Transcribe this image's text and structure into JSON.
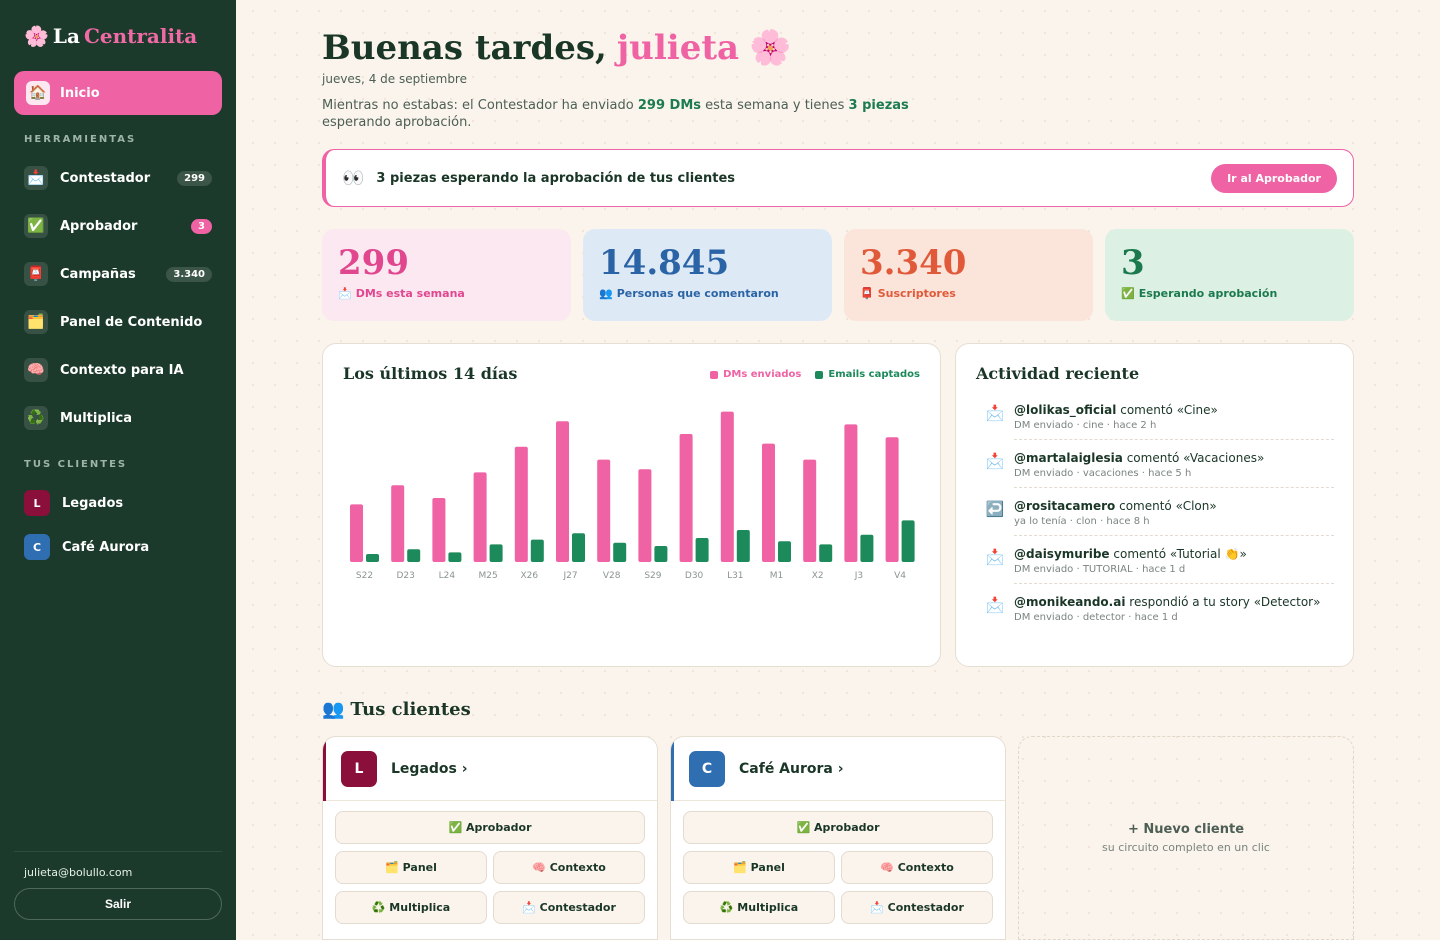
{
  "sidebar": {
    "brand_icon": "🌸",
    "brand_a": "La",
    "brand_b": "Centralita",
    "home": {
      "icon": "🏠",
      "label": "Inicio"
    },
    "tools_heading": "HERRAMIENTAS",
    "items": [
      {
        "icon": "📩",
        "label": "Contestador",
        "badge": "299"
      },
      {
        "icon": "✅",
        "label": "Aprobador",
        "badge": "3"
      },
      {
        "icon": "📮",
        "label": "Campañas",
        "badge": "3.340"
      },
      {
        "icon": "🗂️",
        "label": "Panel de Contenido",
        "badge": ""
      },
      {
        "icon": "🧠",
        "label": "Contexto para IA",
        "badge": ""
      },
      {
        "icon": "♻️",
        "label": "Multiplica",
        "badge": ""
      }
    ],
    "clients_heading": "TUS CLIENTES",
    "clients": [
      {
        "initial": "L",
        "label": "Legados",
        "color": "#8a0f3a"
      },
      {
        "initial": "C",
        "label": "Café Aurora",
        "color": "#2f6eb0"
      }
    ],
    "email": "julieta@bolullo.com",
    "logout": "Salir"
  },
  "header": {
    "greeting": "Buenas tardes,",
    "name": "julieta",
    "flower": "🌸",
    "date": "jueves, 4 de septiembre",
    "summary_a": "Mientras no estabas: el Contestador ha enviado",
    "summary_dms": "299 DMs",
    "summary_b": "esta semana y tienes",
    "summary_pieces": "3 piezas",
    "summary_c": "esperando aprobación."
  },
  "alert": {
    "icon": "👀",
    "text": "3 piezas esperando la aprobación de tus clientes",
    "button": "Ir al Aprobador"
  },
  "stats": [
    {
      "value": "299",
      "icon": "📩",
      "label": "DMs esta semana",
      "bg": "#fce8f1",
      "color": "#e0478f",
      "label_color": "#e0478f"
    },
    {
      "value": "14.845",
      "icon": "👥",
      "label": "Personas que comentaron",
      "bg": "#dde9f5",
      "color": "#2b64a6",
      "label_color": "#2b64a6"
    },
    {
      "value": "3.340",
      "icon": "📮",
      "label": "Suscriptores",
      "bg": "#fbe4da",
      "color": "#e05a3a",
      "label_color": "#e05a3a"
    },
    {
      "value": "3",
      "icon": "✅",
      "label": "Esperando aprobación",
      "bg": "#dcf0e3",
      "color": "#1b7a4d",
      "label_color": "#1b7a4d"
    }
  ],
  "chart_data": {
    "type": "bar",
    "title": "Los últimos 14 días",
    "categories": [
      "S22",
      "D23",
      "L24",
      "M25",
      "X26",
      "J27",
      "V28",
      "S29",
      "D30",
      "L31",
      "M1",
      "X2",
      "J3",
      "V4"
    ],
    "series": [
      {
        "name": "DMs enviados",
        "color": "#ef62a4",
        "values": [
          18,
          24,
          20,
          28,
          36,
          44,
          32,
          29,
          40,
          47,
          37,
          32,
          43,
          39
        ]
      },
      {
        "name": "Emails captados",
        "color": "#1d8a5b",
        "values": [
          2.5,
          4,
          3,
          5.5,
          7,
          9,
          6,
          5,
          7.5,
          10,
          6.5,
          5.5,
          8.5,
          13
        ]
      }
    ],
    "legend": "top-right",
    "grid": false
  },
  "activity": {
    "title": "Actividad reciente",
    "items": [
      {
        "icon": "📩",
        "user": "@lolikas_oficial",
        "action": "comentó «Cine»",
        "meta": "DM enviado · cine · hace 2 h"
      },
      {
        "icon": "📩",
        "user": "@martalaiglesia",
        "action": "comentó «Vacaciones»",
        "meta": "DM enviado · vacaciones · hace 5 h"
      },
      {
        "icon": "↩️",
        "user": "@rositacamero",
        "action": "comentó «Clon»",
        "meta": "ya lo tenía · clon · hace 8 h"
      },
      {
        "icon": "📩",
        "user": "@daisymuribe",
        "action": "comentó «Tutorial 👏»",
        "meta": "DM enviado · TUTORIAL · hace 1 d"
      },
      {
        "icon": "📩",
        "user": "@monikeando.ai",
        "action": "respondió a tu story «Detector»",
        "meta": "DM enviado · detector · hace 1 d"
      }
    ]
  },
  "clients_section": {
    "icon": "👥",
    "title": "Tus clientes",
    "cards": [
      {
        "initial": "L",
        "name": "Legados ›",
        "color": "#8a0f3a",
        "tools": {
          "approve": "✅ Aprobador",
          "panel": "🗂️ Panel",
          "context": "🧠 Contexto",
          "multi": "♻️ Multiplica",
          "reply": "📩 Contestador"
        }
      },
      {
        "initial": "C",
        "name": "Café Aurora ›",
        "color": "#2f6eb0",
        "tools": {
          "approve": "✅ Aprobador",
          "panel": "🗂️ Panel",
          "context": "🧠 Contexto",
          "multi": "♻️ Multiplica",
          "reply": "📩 Contestador"
        }
      }
    ],
    "new_client": {
      "title": "+ Nuevo cliente",
      "subtitle": "su circuito completo en un clic"
    }
  }
}
